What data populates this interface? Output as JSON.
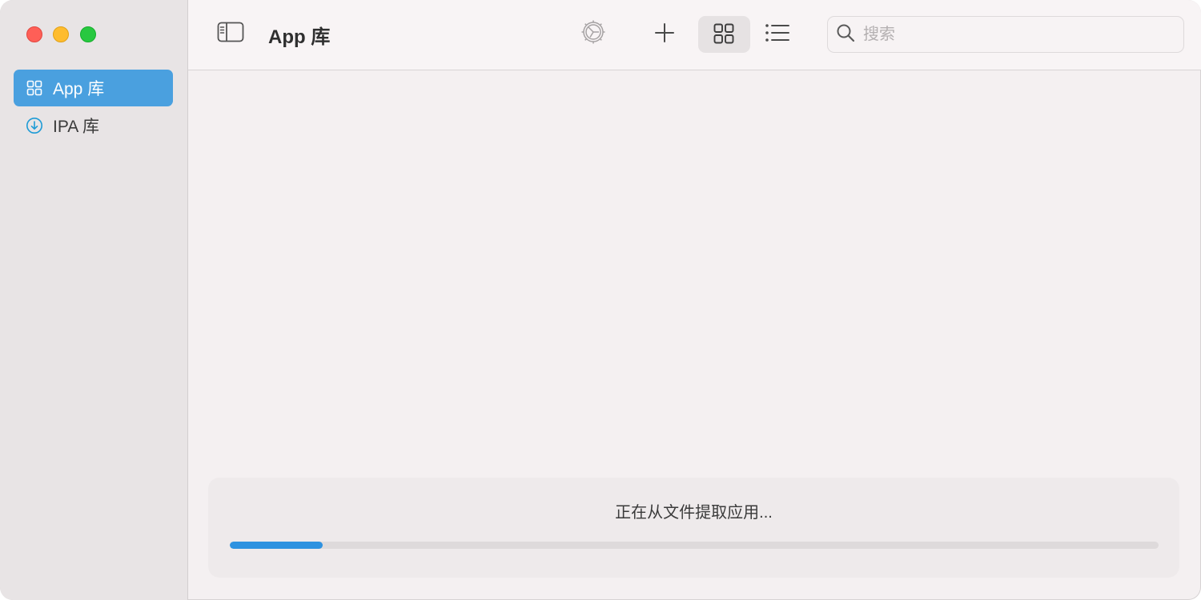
{
  "window": {
    "controls": [
      "close",
      "minimize",
      "zoom"
    ]
  },
  "sidebar": {
    "items": [
      {
        "label": "App 库",
        "icon": "grid-icon",
        "selected": true
      },
      {
        "label": "IPA 库",
        "icon": "download-circle-icon",
        "selected": false
      }
    ]
  },
  "toolbar": {
    "title": "App 库",
    "buttons": [
      {
        "name": "sidebar-toggle",
        "icon": "sidebar-icon"
      },
      {
        "name": "settings",
        "icon": "gear-icon",
        "enabled": false
      },
      {
        "name": "add",
        "icon": "plus-icon"
      },
      {
        "name": "grid-view",
        "icon": "grid-icon",
        "selected": true
      },
      {
        "name": "list-view",
        "icon": "list-icon"
      }
    ],
    "search": {
      "placeholder": "搜索",
      "value": ""
    }
  },
  "progress": {
    "message": "正在从文件提取应用...",
    "fraction": 0.1
  },
  "colors": {
    "accent": "#4aa0df",
    "progress": "#2e92e0",
    "sidebar_bg": "#e8e4e5",
    "content_bg": "#f4f0f1",
    "close": "#fe5f57",
    "minimize": "#febc2e",
    "zoom": "#28c840"
  }
}
